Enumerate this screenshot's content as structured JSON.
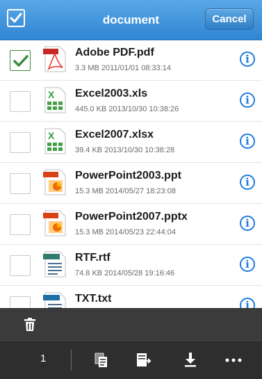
{
  "header": {
    "title": "document",
    "cancel_label": "Cancel"
  },
  "colors": {
    "header_blue": "#2f86d2",
    "check_green": "#3c8a3f",
    "info_blue": "#1f7be0",
    "toolbar_dark": "#2e2e2e"
  },
  "files": [
    {
      "name": "Adobe PDF.pdf",
      "meta": "3.3 MB 2011/01/01 08:33:14",
      "icon": "pdf-icon",
      "checked": true
    },
    {
      "name": "Excel2003.xls",
      "meta": "445.0 KB 2013/10/30 10:38:26",
      "icon": "excel-icon",
      "checked": false
    },
    {
      "name": "Excel2007.xlsx",
      "meta": "39.4 KB 2013/10/30 10:38:28",
      "icon": "excel-icon",
      "checked": false
    },
    {
      "name": "PowerPoint2003.ppt",
      "meta": "15.3 MB 2014/05/27 18:23:08",
      "icon": "powerpoint-icon",
      "checked": false
    },
    {
      "name": "PowerPoint2007.pptx",
      "meta": "15.3 MB 2014/05/23 22:44:04",
      "icon": "powerpoint-icon",
      "checked": false
    },
    {
      "name": "RTF.rtf",
      "meta": "74.8 KB 2014/05/28 19:16:46",
      "icon": "rtf-icon",
      "checked": false
    },
    {
      "name": "TXT.txt",
      "meta": "",
      "icon": "txt-icon",
      "checked": false
    }
  ],
  "toolbar": {
    "selected_count": "1",
    "icons": [
      "trash-icon",
      "copy-icon",
      "move-icon",
      "download-icon",
      "more-icon"
    ]
  }
}
